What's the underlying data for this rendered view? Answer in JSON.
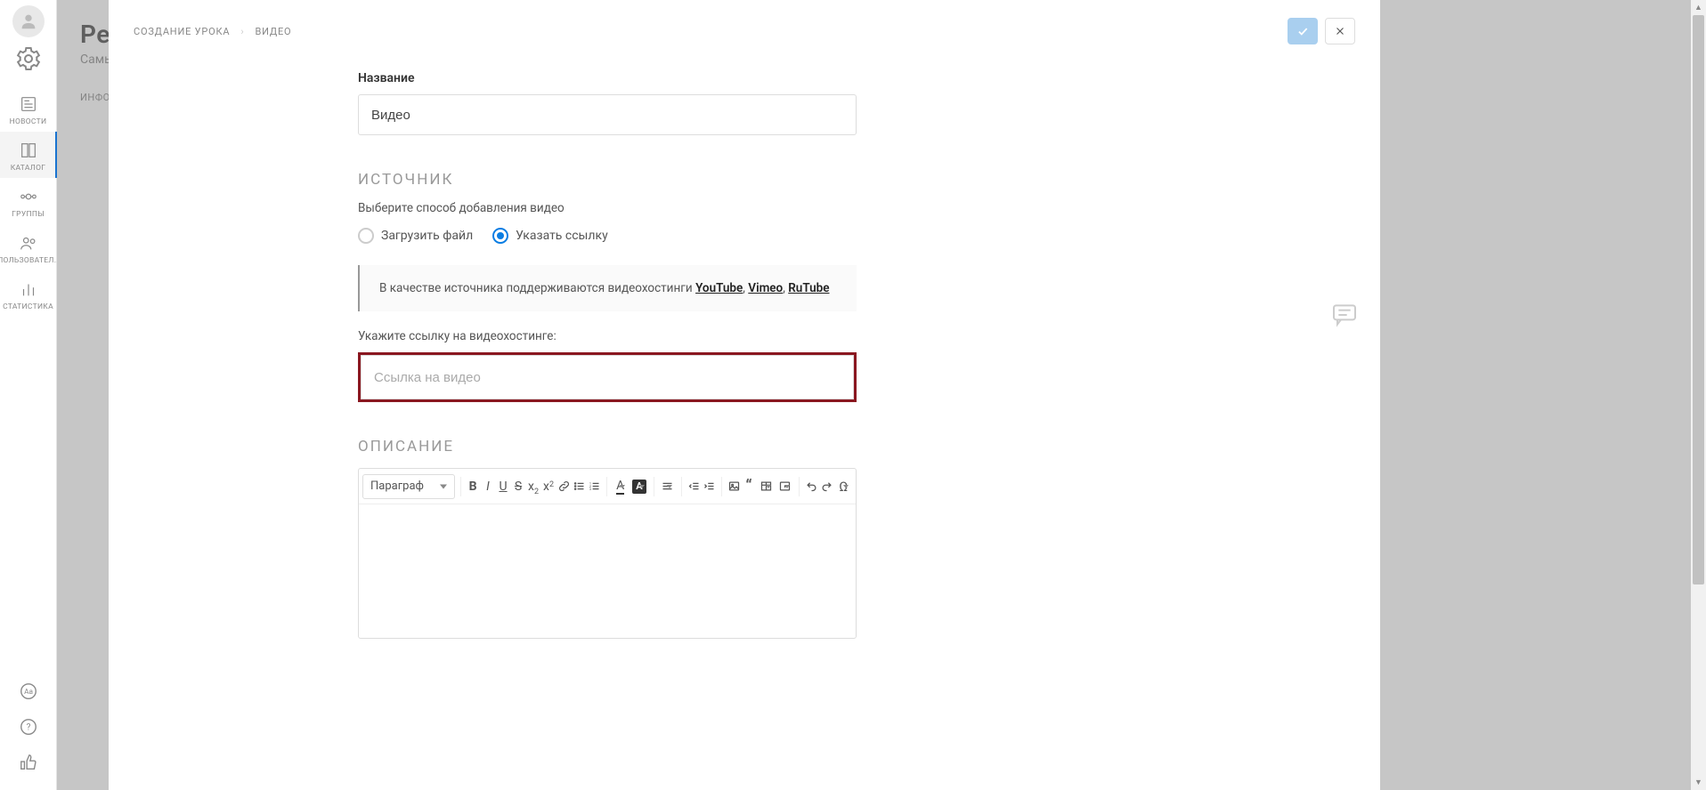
{
  "sidebar": {
    "items": [
      {
        "label": "НОВОСТИ",
        "name": "news"
      },
      {
        "label": "КАТАЛОГ",
        "name": "catalog",
        "active": true
      },
      {
        "label": "ГРУППЫ",
        "name": "groups"
      },
      {
        "label": "ПОЛЬЗОВАТЕЛ..",
        "name": "users"
      },
      {
        "label": "СТАТИСТИКА",
        "name": "stats"
      }
    ]
  },
  "bg": {
    "title": "Ре",
    "subtitle": "Самы",
    "crumb": "ИНФО"
  },
  "modal": {
    "crumb1": "СОЗДАНИЕ УРОКА",
    "crumb2": "ВИДЕО",
    "name_label": "Название",
    "name_value": "Видео",
    "source_title": "ИСТОЧНИК",
    "source_help": "Выберите способ добавления видео",
    "radio_upload": "Загрузить файл",
    "radio_link": "Указать ссылку",
    "info_prefix": "В качестве источника поддерживаются видеохостинги ",
    "hosts": {
      "yt": "YouTube",
      "vm": "Vimeo",
      "rt": "RuTube"
    },
    "link_label": "Укажите ссылку на видеохостинге:",
    "link_placeholder": "Ссылка на видео",
    "desc_title": "ОПИСАНИЕ",
    "toolbar": {
      "paragraph": "Параграф"
    }
  }
}
